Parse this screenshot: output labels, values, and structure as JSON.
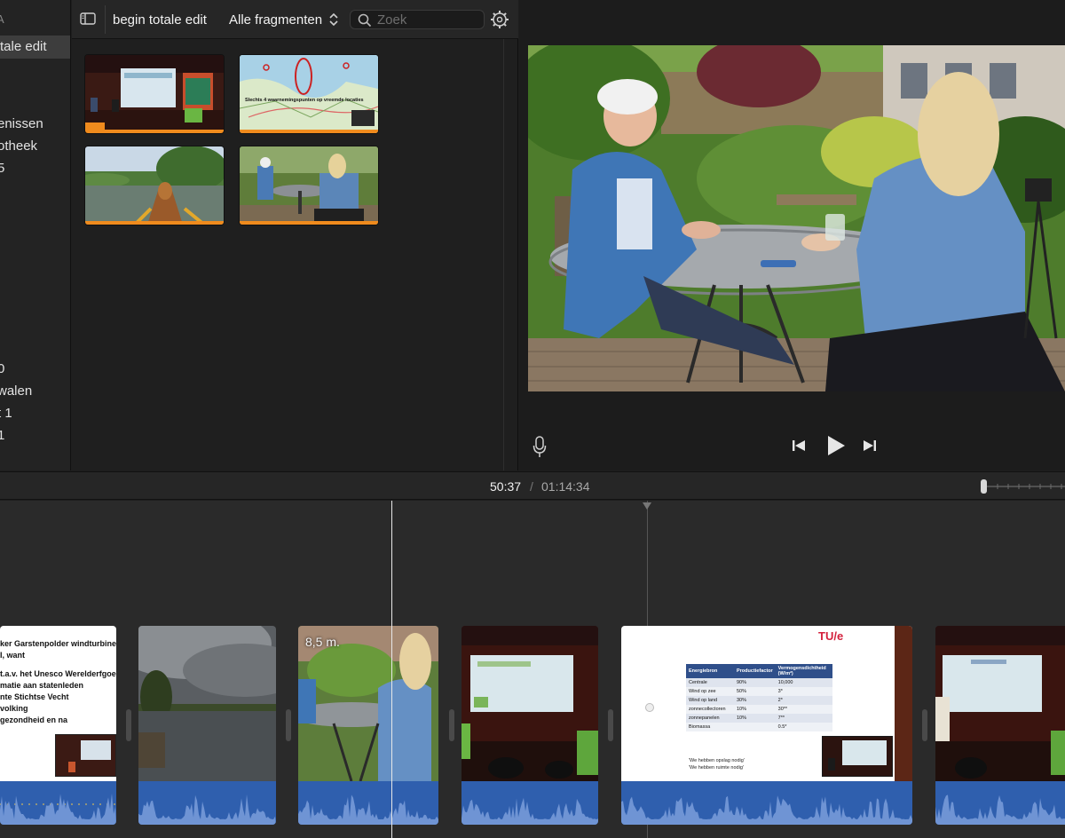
{
  "sidebar": {
    "header": "A",
    "items": [
      {
        "label": "tale edit",
        "selected": true
      },
      {
        "label": "enissen"
      },
      {
        "label": "otheek"
      },
      {
        "label": "5"
      },
      {
        "label": "0"
      },
      {
        "label": "walen"
      },
      {
        "label": "t 1"
      },
      {
        "label": "1"
      }
    ]
  },
  "browser": {
    "event_title": "begin totale edit",
    "filter": "Alle fragmenten",
    "search_placeholder": "Zoek",
    "clips": [
      {
        "name": "presentation-stage-clip"
      },
      {
        "name": "map-clip",
        "caption": "Slechts 4 waarnemingspunten op vreemde locaties"
      },
      {
        "name": "canal-boat-clip"
      },
      {
        "name": "interview-garden-clip"
      }
    ]
  },
  "timeline": {
    "current_time": "50:37",
    "separator": "/",
    "total_time": "01:14:34",
    "clip_label": "8,5 m.",
    "slide1_lines": [
      "ker Garstenpolder windturbines",
      "I, want",
      "t.a.v. het Unesco Werelderfgoed",
      "matie aan statenleden",
      "nte Stichtse Vecht",
      "volking",
      "gezondheid en na"
    ],
    "table_slide": {
      "logo": "TU/e",
      "headers": [
        "Energiebron",
        "Productiefactor",
        "Vermogensdichtheid (W/m²)"
      ],
      "rows": [
        [
          "Centrale",
          "90%",
          "10,000"
        ],
        [
          "Wind op zee",
          "50%",
          "3*"
        ],
        [
          "Wind op land",
          "30%",
          "2*"
        ],
        [
          "zonnecollectoren",
          "10%",
          "30**"
        ],
        [
          "zonnepanelen",
          "10%",
          "7**"
        ],
        [
          "Biomassa",
          "",
          "0.5*"
        ]
      ],
      "notes": [
        "'We hebben opslag nodig'",
        "'We hebben ruimte nodig'"
      ]
    }
  },
  "colors": {
    "accent_orange": "#f08b1d",
    "audio_blue": "#2f5fae",
    "waveform": "#6f94d4"
  }
}
